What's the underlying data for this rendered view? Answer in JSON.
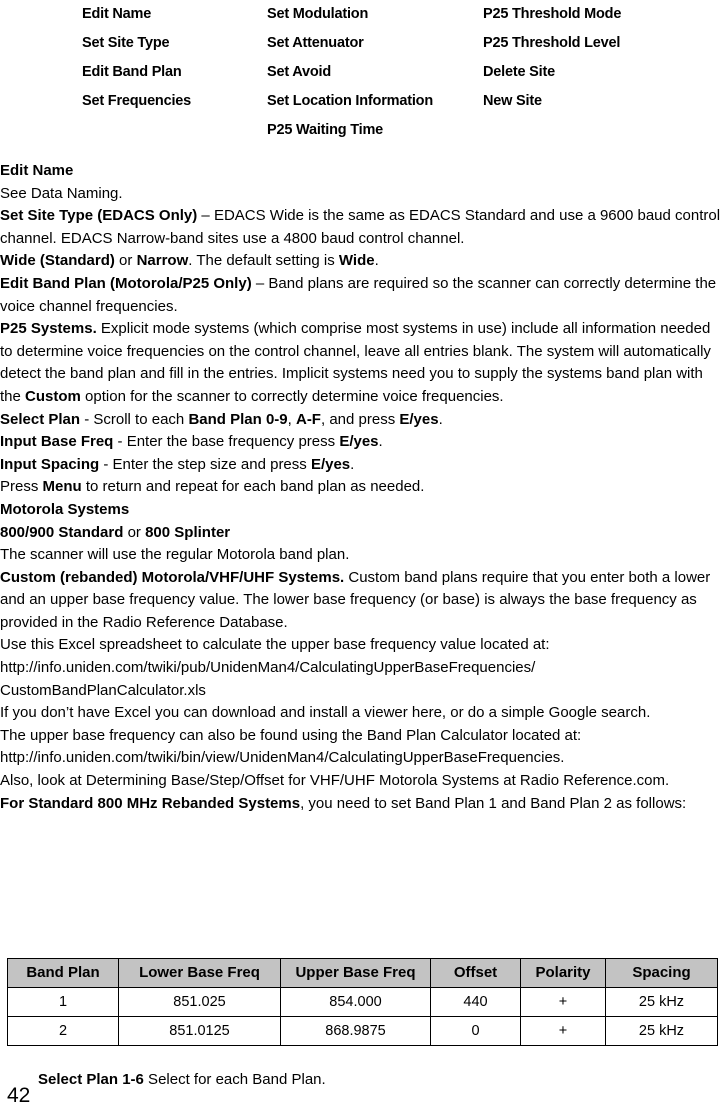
{
  "menu": {
    "columns": [
      {
        "items": [
          "Edit Name",
          "Set Site Type",
          "Edit Band Plan",
          "Set Frequencies",
          ""
        ]
      },
      {
        "items": [
          "Set Modulation",
          "Set Attenuator",
          "Set Avoid",
          "Set Location Information",
          "P25 Waiting Time"
        ]
      },
      {
        "items": [
          "P25 Threshold Mode",
          "P25 Threshold Level",
          "Delete Site",
          "New Site",
          ""
        ]
      }
    ]
  },
  "sections": {
    "edit_name_heading": "Edit Name",
    "edit_name_body": "See Data Naming.",
    "set_site_type_label": "Set Site Type (EDACS Only)",
    "set_site_type_body": " – EDACS Wide is the same as EDACS Standard and use a 9600 baud control channel. EDACS Narrow-band sites use a 4800 baud control channel.",
    "wide_label": "Wide (Standard)",
    "wide_mid": " or ",
    "narrow_label": "Narrow",
    "wide_tail": ". The default setting is ",
    "wide_default": "Wide",
    "wide_period": ".",
    "edit_band_plan_label": "Edit Band Plan (Motorola/P25 Only)",
    "edit_band_plan_body": " – Band plans are required so the scanner can correctly determine the voice channel frequencies.",
    "p25_systems_label": "P25 Systems.",
    "p25_systems_body_1": " Explicit mode systems (which comprise most systems in use) include all information needed to determine voice frequencies on the control channel, leave all entries blank. The system will automatically detect the band plan and fill in the entries. Implicit systems need you to supply the systems band plan with the ",
    "p25_systems_custom": "Custom",
    "p25_systems_body_2": " option for the scanner to correctly determine voice frequencies.",
    "select_plan_label": "Select Plan",
    "select_plan_mid_1": " - Scroll to each ",
    "select_plan_bandplan": "Band Plan 0-9",
    "select_plan_comma": ", ",
    "select_plan_af": "A-F",
    "select_plan_mid_2": ", and press ",
    "select_plan_eyes": "E/yes",
    "select_plan_period": ".",
    "input_base_label": "Input Base Freq",
    "input_base_mid": " - Enter the base frequency press ",
    "input_base_eyes": "E/yes",
    "input_base_period": ".",
    "input_spacing_label": "Input Spacing",
    "input_spacing_mid": " - Enter the step size and press ",
    "input_spacing_eyes": "E/yes",
    "input_spacing_period": ".",
    "press_menu_pre": "Press ",
    "press_menu_label": "Menu",
    "press_menu_post": " to return and repeat for each band plan as needed.",
    "motorola_systems_heading": "Motorola Systems",
    "standard_800900": "800/900 Standard",
    "standard_mid": " or ",
    "splinter_800": "800 Splinter",
    "regular_band_plan_body": "The scanner will use the regular Motorola band plan.",
    "custom_rebanded_label": "Custom (rebanded) Motorola/VHF/UHF Systems.",
    "custom_rebanded_body": " Custom band plans require that you enter both a lower and an upper base frequency value. The lower base frequency (or base) is always the base frequency as provided in the Radio Reference Database.",
    "excel_body": "Use this Excel spreadsheet to calculate the upper base frequency value located at: http://info.uniden.com/twiki/pub/UnidenMan4/CalculatingUpperBaseFrequencies/ CustomBandPlanCalculator.xls",
    "no_excel_body": "If you don’t have Excel you can download and install a viewer here, or do a simple Google search.",
    "calculator_body": "The upper base frequency can also be found using the Band Plan Calculator located at: http://info.uniden.com/twiki/bin/view/UnidenMan4/CalculatingUpperBaseFrequencies.",
    "also_look_body": "Also, look at Determining Base/Step/Offset for VHF/UHF Motorola Systems at Radio Reference.com.",
    "for_standard_label": "For Standard 800 MHz Rebanded Systems",
    "for_standard_body": ", you need to set Band Plan 1 and Band Plan 2 as follows:",
    "select_plan_16_label": "Select Plan 1-6",
    "select_plan_16_body": " Select for each Band Plan."
  },
  "band_plan_table": {
    "headers": [
      "Band Plan",
      "Lower Base Freq",
      "Upper Base Freq",
      "Offset",
      "Polarity",
      "Spacing"
    ],
    "rows": [
      [
        "1",
        "851.025",
        "854.000",
        "440",
        "+",
        "25 kHz"
      ],
      [
        "2",
        "851.0125",
        "868.9875",
        "0",
        "+",
        "25 kHz"
      ]
    ]
  },
  "footer": {
    "page_number": "42"
  },
  "colors": {
    "table_header_bg": "#c3c3c3",
    "border": "#000000",
    "text": "#000000",
    "page_bg": "#ffffff"
  }
}
